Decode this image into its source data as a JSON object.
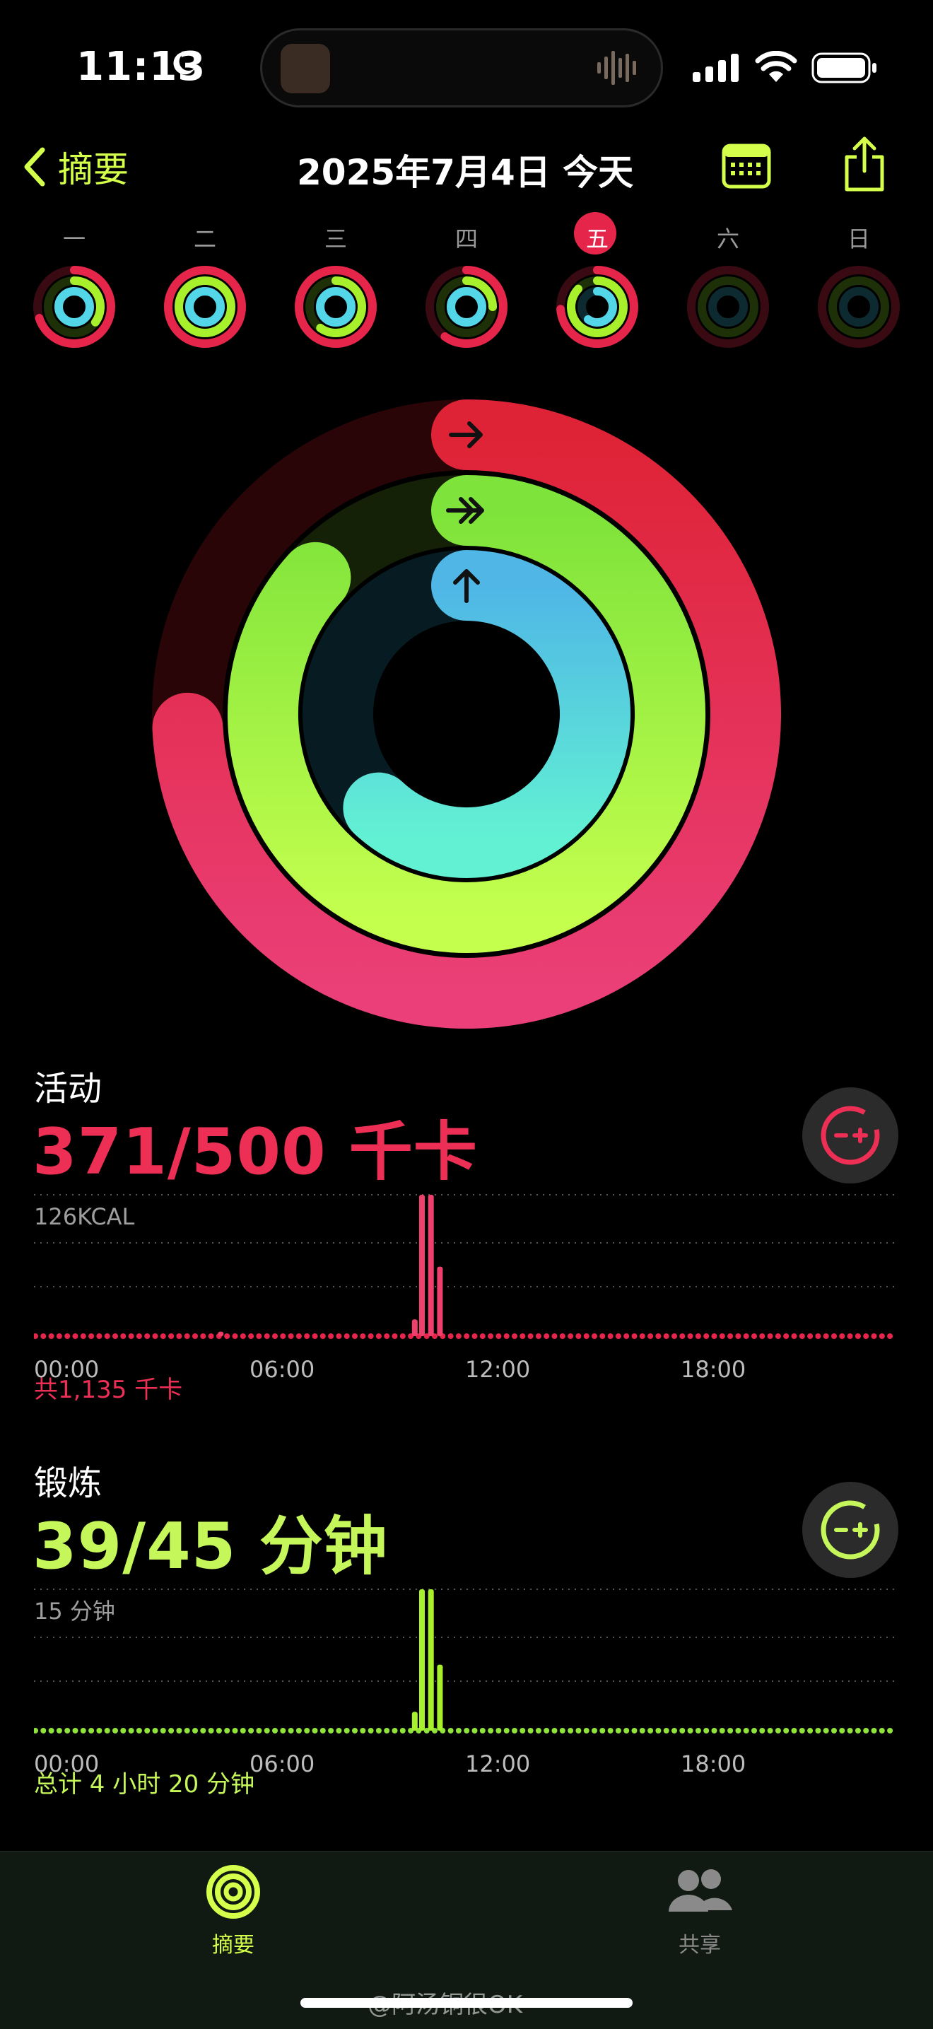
{
  "status_bar": {
    "time": "11:13",
    "moon": "moon-icon",
    "signal": "cellular-signal-icon",
    "wifi": "wifi-icon",
    "battery": "battery-icon"
  },
  "nav": {
    "back_label": "摘要",
    "title": "2025年7月4日 今天",
    "calendar": "calendar-icon",
    "share": "share-icon"
  },
  "colors": {
    "move": "#e5264a",
    "exercise": "#a8f02c",
    "stand": "#52d6e8",
    "accent": "#d4ff4a"
  },
  "week": {
    "days": [
      {
        "label": "一",
        "move": 0.7,
        "exercise": 0.35,
        "stand": 1.0
      },
      {
        "label": "二",
        "move": 1.0,
        "exercise": 1.0,
        "stand": 1.0
      },
      {
        "label": "三",
        "move": 1.0,
        "exercise": 0.6,
        "stand": 1.0
      },
      {
        "label": "四",
        "move": 0.6,
        "exercise": 0.25,
        "stand": 1.0
      },
      {
        "label": "五",
        "move": 0.74,
        "exercise": 0.87,
        "stand": 0.6,
        "today": true
      },
      {
        "label": "六",
        "move": 0,
        "exercise": 0,
        "stand": 0
      },
      {
        "label": "日",
        "move": 0,
        "exercise": 0,
        "stand": 0
      }
    ]
  },
  "rings": {
    "move_progress": 0.742,
    "exercise_progress": 0.867,
    "stand_progress": 0.62
  },
  "activity": {
    "title": "活动",
    "value": "371/500 千卡",
    "peak_label": "126KCAL",
    "x_ticks": [
      "00:00",
      "06:00",
      "12:00",
      "18:00"
    ],
    "total": "共1,135 千卡",
    "bars": [
      {
        "hour": 10.6,
        "value": 15
      },
      {
        "hour": 10.8,
        "value": 126
      },
      {
        "hour": 11.05,
        "value": 126
      },
      {
        "hour": 11.3,
        "value": 62
      },
      {
        "hour": 5.2,
        "value": 4
      }
    ]
  },
  "exercise": {
    "title": "锻炼",
    "value": "39/45 分钟",
    "peak_label": "15 分钟",
    "x_ticks": [
      "00:00",
      "06:00",
      "12:00",
      "18:00"
    ],
    "total": "总计 4 小时 20 分钟",
    "bars": [
      {
        "hour": 10.6,
        "value": 2
      },
      {
        "hour": 10.8,
        "value": 15
      },
      {
        "hour": 11.05,
        "value": 15
      },
      {
        "hour": 11.3,
        "value": 7
      }
    ]
  },
  "tabs": [
    {
      "label": "摘要",
      "icon": "activity-rings-icon",
      "active": true
    },
    {
      "label": "共享",
      "icon": "people-icon",
      "active": false
    }
  ],
  "watermark": "@阿汤铜很OK"
}
